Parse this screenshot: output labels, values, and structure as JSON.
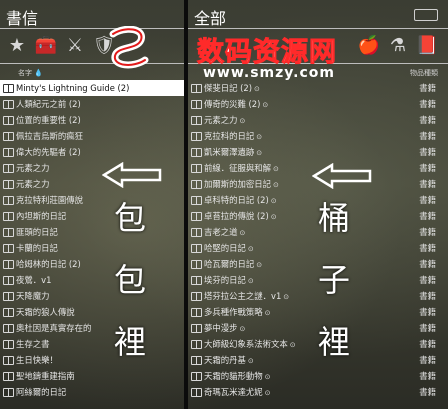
{
  "left": {
    "title": "書信",
    "col_name": "名字",
    "col_drop": "💧",
    "tabs": [
      {
        "name": "star-icon",
        "glyph": "★",
        "selected": false
      },
      {
        "name": "chest-icon",
        "glyph": "🧰",
        "selected": false
      },
      {
        "name": "swords-icon",
        "glyph": "⚔",
        "selected": false
      },
      {
        "name": "shield-icon",
        "glyph": "🛡",
        "selected": false
      }
    ],
    "items": [
      {
        "label": "Minty's Lightning Guide (2)",
        "selected": true
      },
      {
        "label": "人類紀元之前 (2)"
      },
      {
        "label": "位置的重要性 (2)"
      },
      {
        "label": "佩拉吉烏斯的瘋狂"
      },
      {
        "label": "偉大的先驅者 (2)"
      },
      {
        "label": "元素之力"
      },
      {
        "label": "元素之力"
      },
      {
        "label": "克拉特利莊園傳說"
      },
      {
        "label": "內坦斯的日記"
      },
      {
        "label": "匪頭的日記"
      },
      {
        "label": "卡蘭的日記"
      },
      {
        "label": "哈姆林的日記 (2)"
      },
      {
        "label": "夜鶯．v1"
      },
      {
        "label": "天降魔力"
      },
      {
        "label": "天霜的狼人傳說"
      },
      {
        "label": "奧杜因是真實存在的"
      },
      {
        "label": "生存之書"
      },
      {
        "label": "生日快樂！"
      },
      {
        "label": "聖地鑄重建指南"
      },
      {
        "label": "阿絲爾的日記"
      }
    ]
  },
  "right": {
    "title": "全部",
    "col_type": "物品種類",
    "tabs": [
      {
        "name": "apple-icon",
        "glyph": "🍎"
      },
      {
        "name": "mortar-icon",
        "glyph": "⚗"
      },
      {
        "name": "book-icon",
        "glyph": "📕"
      }
    ],
    "items": [
      {
        "label": "傑斐日記 (2)",
        "tag": "⊙",
        "type": "書籍"
      },
      {
        "label": "傳奇的災難 (2)",
        "tag": "⊙",
        "type": "書籍"
      },
      {
        "label": "元素之力",
        "tag": "⊙",
        "type": "書籍"
      },
      {
        "label": "克拉科的日記",
        "tag": "⊙",
        "type": "書籍"
      },
      {
        "label": "凱米爾澤遺跡",
        "tag": "⊙",
        "type": "書籍"
      },
      {
        "label": "前線．征服與和解",
        "tag": "⊙",
        "type": "書籍"
      },
      {
        "label": "加爾斯的加密日記",
        "tag": "⊙",
        "type": "書籍"
      },
      {
        "label": "卓科特的日記 (2)",
        "tag": "⊙",
        "type": "書籍"
      },
      {
        "label": "卓苔拉的傳說 (2)",
        "tag": "⊙",
        "type": "書籍"
      },
      {
        "label": "吉老之道",
        "tag": "⊙",
        "type": "書籍"
      },
      {
        "label": "哈堅的日記",
        "tag": "⊙",
        "type": "書籍"
      },
      {
        "label": "哈瓦爾的日記",
        "tag": "⊙",
        "type": "書籍"
      },
      {
        "label": "埃芬的日記",
        "tag": "⊙",
        "type": "書籍"
      },
      {
        "label": "塔芬拉公主之謎．v1",
        "tag": "⊙",
        "type": "書籍"
      },
      {
        "label": "多兵種作戰策略",
        "tag": "⊙",
        "type": "書籍"
      },
      {
        "label": "夢中漫步",
        "tag": "⊙",
        "type": "書籍"
      },
      {
        "label": "大師級幻象系法術文本",
        "tag": "⊙",
        "type": "書籍"
      },
      {
        "label": "天霜的丹基",
        "tag": "⊙",
        "type": "書籍"
      },
      {
        "label": "天霜的貓形動物",
        "tag": "⊙",
        "type": "書籍"
      },
      {
        "label": "奇瑪瓦米達尤妮",
        "tag": "⊙",
        "type": "書籍"
      }
    ]
  },
  "annotations": {
    "left": [
      "包",
      "包",
      "裡"
    ],
    "right": [
      "桶",
      "子",
      "裡"
    ]
  },
  "watermark": {
    "cn": "数码资源网",
    "url": "www.smzy.com"
  }
}
